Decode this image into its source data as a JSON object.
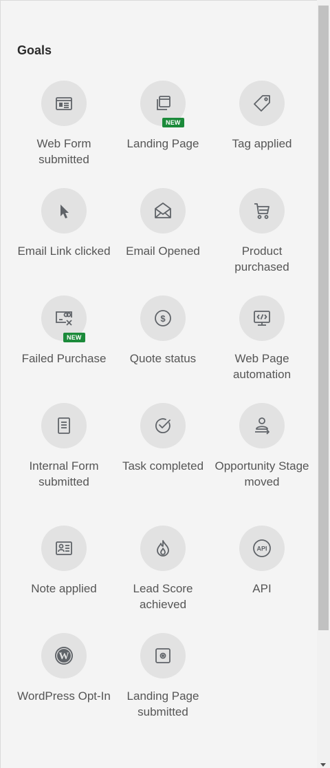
{
  "goals": {
    "title": "Goals",
    "new_badge": "NEW",
    "items": [
      {
        "label": "Web Form submitted",
        "icon": "web-form-icon",
        "new": false
      },
      {
        "label": "Landing Page",
        "icon": "landing-page-icon",
        "new": true
      },
      {
        "label": "Tag applied",
        "icon": "tag-icon",
        "new": false
      },
      {
        "label": "Email Link clicked",
        "icon": "cursor-icon",
        "new": false
      },
      {
        "label": "Email Opened",
        "icon": "envelope-open-icon",
        "new": false
      },
      {
        "label": "Product purchased",
        "icon": "cart-icon",
        "new": false
      },
      {
        "label": "Failed Purchase",
        "icon": "failed-card-icon",
        "new": true
      },
      {
        "label": "Quote status",
        "icon": "dollar-icon",
        "new": false
      },
      {
        "label": "Web Page automation",
        "icon": "code-monitor-icon",
        "new": false
      },
      {
        "label": "Internal Form submitted",
        "icon": "document-icon",
        "new": false
      },
      {
        "label": "Task completed",
        "icon": "check-circle-icon",
        "new": false
      },
      {
        "label": "Opportunity Stage moved",
        "icon": "person-arrow-icon",
        "new": false
      },
      {
        "label": "Note applied",
        "icon": "contact-card-icon",
        "new": false
      },
      {
        "label": "Lead Score achieved",
        "icon": "flame-icon",
        "new": false
      },
      {
        "label": "API",
        "icon": "api-icon",
        "new": false
      },
      {
        "label": "WordPress Opt-In",
        "icon": "wordpress-icon",
        "new": false
      },
      {
        "label": "Landing Page submitted",
        "icon": "square-dot-icon",
        "new": false
      }
    ]
  },
  "colors": {
    "panel_bg": "#f4f4f4",
    "icon_bg": "#e2e2e2",
    "icon_stroke": "#5f6368",
    "label": "#555555",
    "badge": "#1b8a3a"
  }
}
